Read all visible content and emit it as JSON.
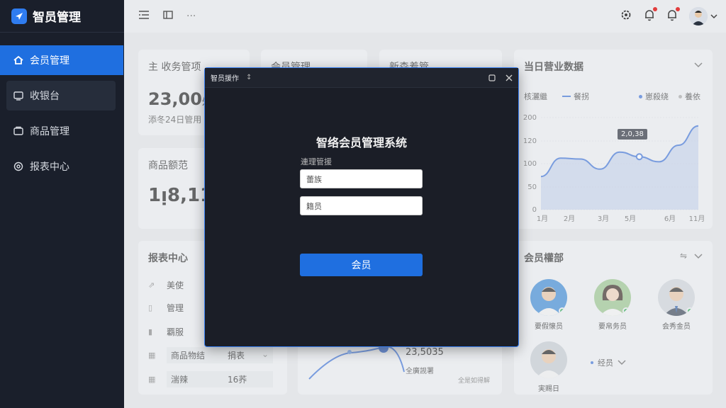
{
  "app": {
    "title": "智员管理"
  },
  "sidebar": {
    "items": [
      {
        "label": "会员管理",
        "icon": "home-icon"
      },
      {
        "label": "收银台",
        "icon": "cashier-icon"
      },
      {
        "label": "商品管理",
        "icon": "goods-icon"
      },
      {
        "label": "报表中心",
        "icon": "report-icon"
      }
    ]
  },
  "topbar": {
    "left_icons": [
      "menu-icon",
      "fold-icon",
      "more-icon"
    ]
  },
  "cards": {
    "member_mgmt": {
      "title": "主  收务管项",
      "value": "23,00",
      "unit": "舛",
      "sub": "添冬24日管用"
    },
    "member_mgmt2": {
      "title": "会员管理"
    },
    "new_mgmt": {
      "title": "新森着管"
    },
    "goods_mgmt": {
      "title": "商品额范",
      "value": "1ᴉ8,11"
    },
    "report": {
      "title": "报表中心",
      "rows": [
        {
          "label": "美使",
          "value": ""
        },
        {
          "label": "管理",
          "value": ""
        },
        {
          "label": "覇服",
          "value": ""
        },
        {
          "label": "商品物结",
          "value": "捐表"
        },
        {
          "label": "湍辣",
          "value": "16荞"
        }
      ]
    },
    "mid_bottom": {
      "value": "23,5035",
      "sub": "全廣觊署",
      "foot": "全是如得解"
    },
    "members": {
      "title": "会员權部",
      "people": [
        {
          "name": "要假懐员"
        },
        {
          "name": "要帛务员"
        },
        {
          "name": "会秀金员"
        },
        {
          "name": "実赐日"
        }
      ],
      "pager": "经员"
    }
  },
  "chart_card": {
    "title": "当日营业数据",
    "legend_left": "核灑繼",
    "legend_mid": "餐拐",
    "legend_r1": "崽殺绕",
    "legend_r2": "養依",
    "tooltip": "2,0,38"
  },
  "chart_data": {
    "type": "area",
    "x": [
      "1月",
      "2月",
      "3月",
      "5月",
      "6月",
      "11月"
    ],
    "yticks": [
      0,
      50,
      100,
      120,
      200
    ],
    "ylim": [
      0,
      200
    ],
    "series": [
      {
        "values": [
          72,
          112,
          110,
          88,
          125,
          115,
          104,
          140,
          182
        ]
      }
    ],
    "colors": {
      "line": "#3f73d8",
      "fill": "#b9cbe9"
    }
  },
  "dialog": {
    "header_title": "智员援作",
    "header_extra": "↕",
    "title": "智络会员管理系统",
    "label": "連理管援",
    "input1_placeholder": "蕾族",
    "input2_placeholder": "籍员",
    "button": "会员"
  }
}
